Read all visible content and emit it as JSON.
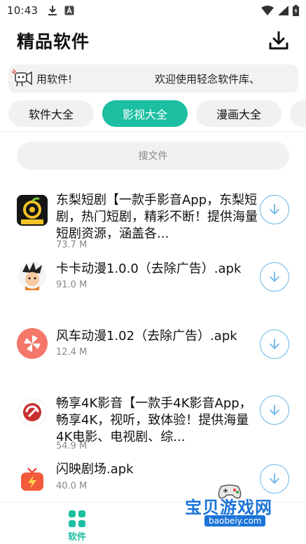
{
  "status_bar": {
    "time": "10:43"
  },
  "header": {
    "title": "精品软件"
  },
  "notice": {
    "text_a": "用软件!",
    "text_b": "欢迎使用轻念软件库、"
  },
  "tabs": [
    {
      "label": "软件大全",
      "active": false
    },
    {
      "label": "影视大全",
      "active": true
    },
    {
      "label": "漫画大全",
      "active": false
    }
  ],
  "search": {
    "placeholder": "搜文件"
  },
  "files": [
    {
      "name": "东梨短剧【一款手影音App，东梨短剧，热门短剧，精彩不断！提供海量短剧资源，涵盖各...",
      "size": "73.7 M",
      "icon": "dongli-app-icon"
    },
    {
      "name": "卡卡动漫1.0.0（去除广告）.apk",
      "size": "91.0 M",
      "icon": "kaka-anime-icon"
    },
    {
      "name": "风车动漫1.02（去除广告）.apk",
      "size": "12.4 M",
      "icon": "pinwheel-icon"
    },
    {
      "name": "畅享4K影音【一款手4K影音App，畅享4K，视听，致体验！提供海量4K电影、电视剧、综...",
      "size": "54.9 M",
      "icon": "changxiang-icon"
    },
    {
      "name": "闪映剧场.apk",
      "size": "40.0 M",
      "icon": "shanying-tv-icon"
    }
  ],
  "bottom_nav": {
    "software_label": "软件"
  },
  "watermark": {
    "title": "宝贝游戏网",
    "url": "baobeiy.com"
  },
  "colors": {
    "accent": "#1cbfa1",
    "download_ring": "#6cb6e6"
  }
}
